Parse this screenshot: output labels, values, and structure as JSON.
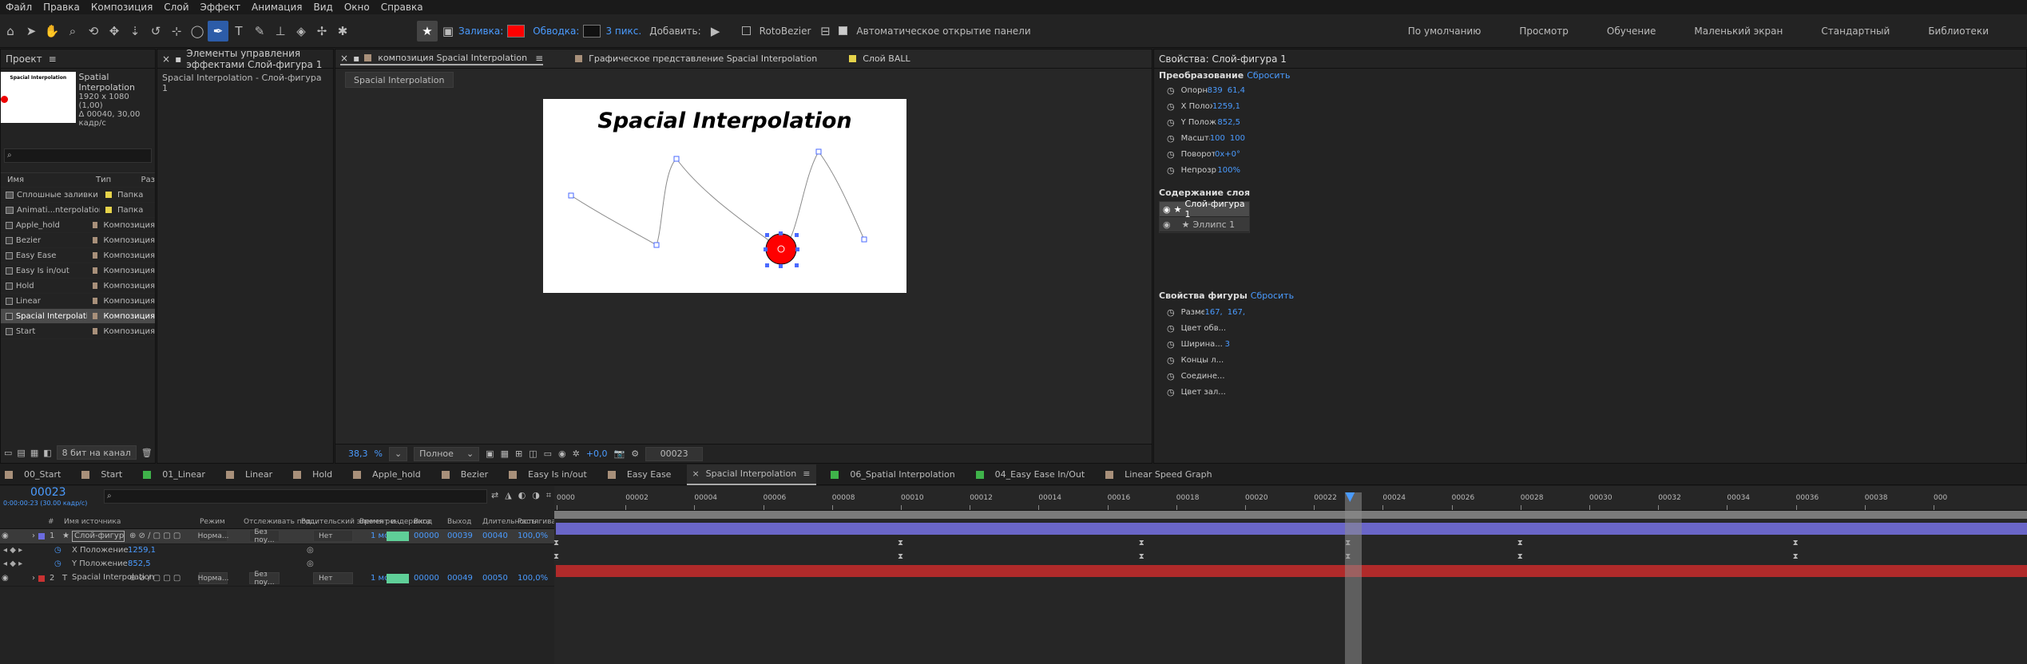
{
  "menu": [
    "Файл",
    "Правка",
    "Композиция",
    "Слой",
    "Эффект",
    "Анимация",
    "Вид",
    "Окно",
    "Справка"
  ],
  "toolbar": {
    "fill_label": "Заливка:",
    "stroke_label": "Обводка:",
    "stroke_width": "3 пикс.",
    "add_label": "Добавить:",
    "rotobezier": "RotoBezier",
    "auto_open": "Автоматическое открытие панели",
    "fill_color": "#ff0000",
    "stroke_color": "#000000"
  },
  "workspaces": [
    "По умолчанию",
    "Просмотр",
    "Обучение",
    "Маленький экран",
    "Стандартный",
    "Библиотеки"
  ],
  "project": {
    "tab": "Проект",
    "comp_name": "Spatial Interpolation",
    "thumb_title": "Spacial Interpolation",
    "comp_size": "1920 x 1080 (1,00)",
    "comp_info": "Δ 00040, 30,00 кадр/с",
    "col_name": "Имя",
    "col_type": "Тип",
    "col_size": "Раз",
    "depth": "8 бит на канал",
    "items": [
      {
        "name": "Сплошные заливки",
        "type": "Папка",
        "color": "#e6d34a",
        "folder": true
      },
      {
        "name": "Animati...nterpolation_Start.aep",
        "type": "Папка",
        "color": "#e6d34a",
        "folder": true
      },
      {
        "name": "Apple_hold",
        "type": "Композиция",
        "color": "#a8907a"
      },
      {
        "name": "Bezier",
        "type": "Композиция",
        "color": "#a8907a"
      },
      {
        "name": "Easy Ease",
        "type": "Композиция",
        "color": "#a8907a"
      },
      {
        "name": "Easy Is in/out",
        "type": "Композиция",
        "color": "#a8907a"
      },
      {
        "name": "Hold",
        "type": "Композиция",
        "color": "#a8907a"
      },
      {
        "name": "Linear",
        "type": "Композиция",
        "color": "#a8907a"
      },
      {
        "name": "Spacial Interpolation",
        "type": "Композиция",
        "color": "#a8907a",
        "selected": true
      },
      {
        "name": "Start",
        "type": "Композиция",
        "color": "#a8907a"
      }
    ]
  },
  "effects": {
    "tab": "Элементы управления эффектами Слой-фигура 1",
    "subtitle": "Spacial Interpolation - Слой-фигура 1"
  },
  "viewer": {
    "tabs": [
      "композиция Spacial Interpolation",
      "Графическое представление Spacial Interpolation",
      "Слой BALL"
    ],
    "breadcrumb": "Spacial Interpolation",
    "title": "Spacial Interpolation",
    "zoom": "38,3",
    "zoom_unit": "%",
    "quality": "Полное",
    "exposure": "+0,0",
    "timecode": "00023"
  },
  "properties": {
    "title": "Свойства: Слой-фигура 1",
    "transform": "Преобразование",
    "reset": "Сбросить",
    "rows": [
      {
        "label": "Опорная...",
        "v1": "839",
        "v2": "61,4"
      },
      {
        "label": "X Полож...",
        "v1": "1259,1",
        "v2": ""
      },
      {
        "label": "Y Полож...",
        "v1": "852,5",
        "v2": ""
      },
      {
        "label": "Масштаб",
        "v1": "100",
        "v2": "100"
      },
      {
        "label": "Поворот",
        "v1": "0x+0°",
        "v2": ""
      },
      {
        "label": "Непрозр...",
        "v1": "100%",
        "v2": ""
      }
    ],
    "layer_content": "Содержание слоя",
    "layer1": "Слой-фигура 1",
    "layer2": "Эллипс 1",
    "shape_props": "Свойства фигуры",
    "shape_rows": [
      {
        "label": "Размер",
        "v1": "167,",
        "v2": "167,"
      },
      {
        "label": "Цвет обв...",
        "v1": "",
        "v2": ""
      },
      {
        "label": "Ширина...",
        "v1": "3",
        "v2": ""
      },
      {
        "label": "Концы л...",
        "v1": "",
        "v2": ""
      },
      {
        "label": "Соедине...",
        "v1": "",
        "v2": ""
      },
      {
        "label": "Цвет зал...",
        "v1": "",
        "v2": ""
      }
    ]
  },
  "timeline": {
    "tabs": [
      {
        "label": "00_Start",
        "color": "#a8907a"
      },
      {
        "label": "Start",
        "color": "#a8907a"
      },
      {
        "label": "01_Linear",
        "color": "#3fb34a"
      },
      {
        "label": "Linear",
        "color": "#a8907a"
      },
      {
        "label": "Hold",
        "color": "#a8907a"
      },
      {
        "label": "Apple_hold",
        "color": "#a8907a"
      },
      {
        "label": "Bezier",
        "color": "#a8907a"
      },
      {
        "label": "Easy Is in/out",
        "color": "#a8907a"
      },
      {
        "label": "Easy Ease",
        "color": "#a8907a"
      },
      {
        "label": "Spacial Interpolation",
        "color": "#a8907a",
        "active": true
      },
      {
        "label": "06_Spatial Interpolation",
        "color": "#3fb34a"
      },
      {
        "label": "04_Easy Ease In/Out",
        "color": "#3fb34a"
      },
      {
        "label": "Linear Speed Graph",
        "color": "#a8907a"
      }
    ],
    "timecode": "00023",
    "timecode_sub": "0:00:00:23 (30.00 кадр/с)",
    "headers": {
      "num": "#",
      "name": "Имя источника",
      "mode": "Режим",
      "track": "Отслеживать под...",
      "parent": "Родительский элемент и...",
      "stretch_time": "Время рендеринга",
      "in": "Вход",
      "out": "Выход",
      "dur": "Длительность",
      "stretch": "Растягиван..."
    },
    "ruler": [
      "0000",
      "00002",
      "00004",
      "00006",
      "00008",
      "00010",
      "00012",
      "00014",
      "00016",
      "00018",
      "00020",
      "00022",
      "00024",
      "00026",
      "00028",
      "00030",
      "00032",
      "00034",
      "00036",
      "00038",
      "000"
    ],
    "layers": [
      {
        "num": "1",
        "name": "Слой-фигура 1",
        "mode": "Норма...",
        "track": "Без поу...",
        "parent": "Нет",
        "time": "1 мс",
        "in": "00000",
        "out": "00039",
        "dur": "00040",
        "stretch": "100,0%",
        "color": "#6b6bdf"
      },
      {
        "num": "2",
        "name": "Spacial Interpolation",
        "mode": "Норма...",
        "track": "Без поу...",
        "parent": "Нет",
        "time": "1 мс",
        "in": "00000",
        "out": "00049",
        "dur": "00050",
        "stretch": "100,0%",
        "color": "#c83232"
      }
    ],
    "sub": [
      {
        "name": "X Положение",
        "value": "1259,1"
      },
      {
        "name": "Y Положение",
        "value": "852,5"
      }
    ],
    "current_frame": 23,
    "keyframes_x": [
      0,
      10,
      17,
      23,
      28,
      36
    ],
    "keyframes_y": [
      0,
      10,
      17,
      23,
      28,
      36
    ]
  },
  "motion_path": [
    [
      0,
      0
    ],
    [
      1,
      1
    ],
    [
      2,
      2
    ]
  ]
}
